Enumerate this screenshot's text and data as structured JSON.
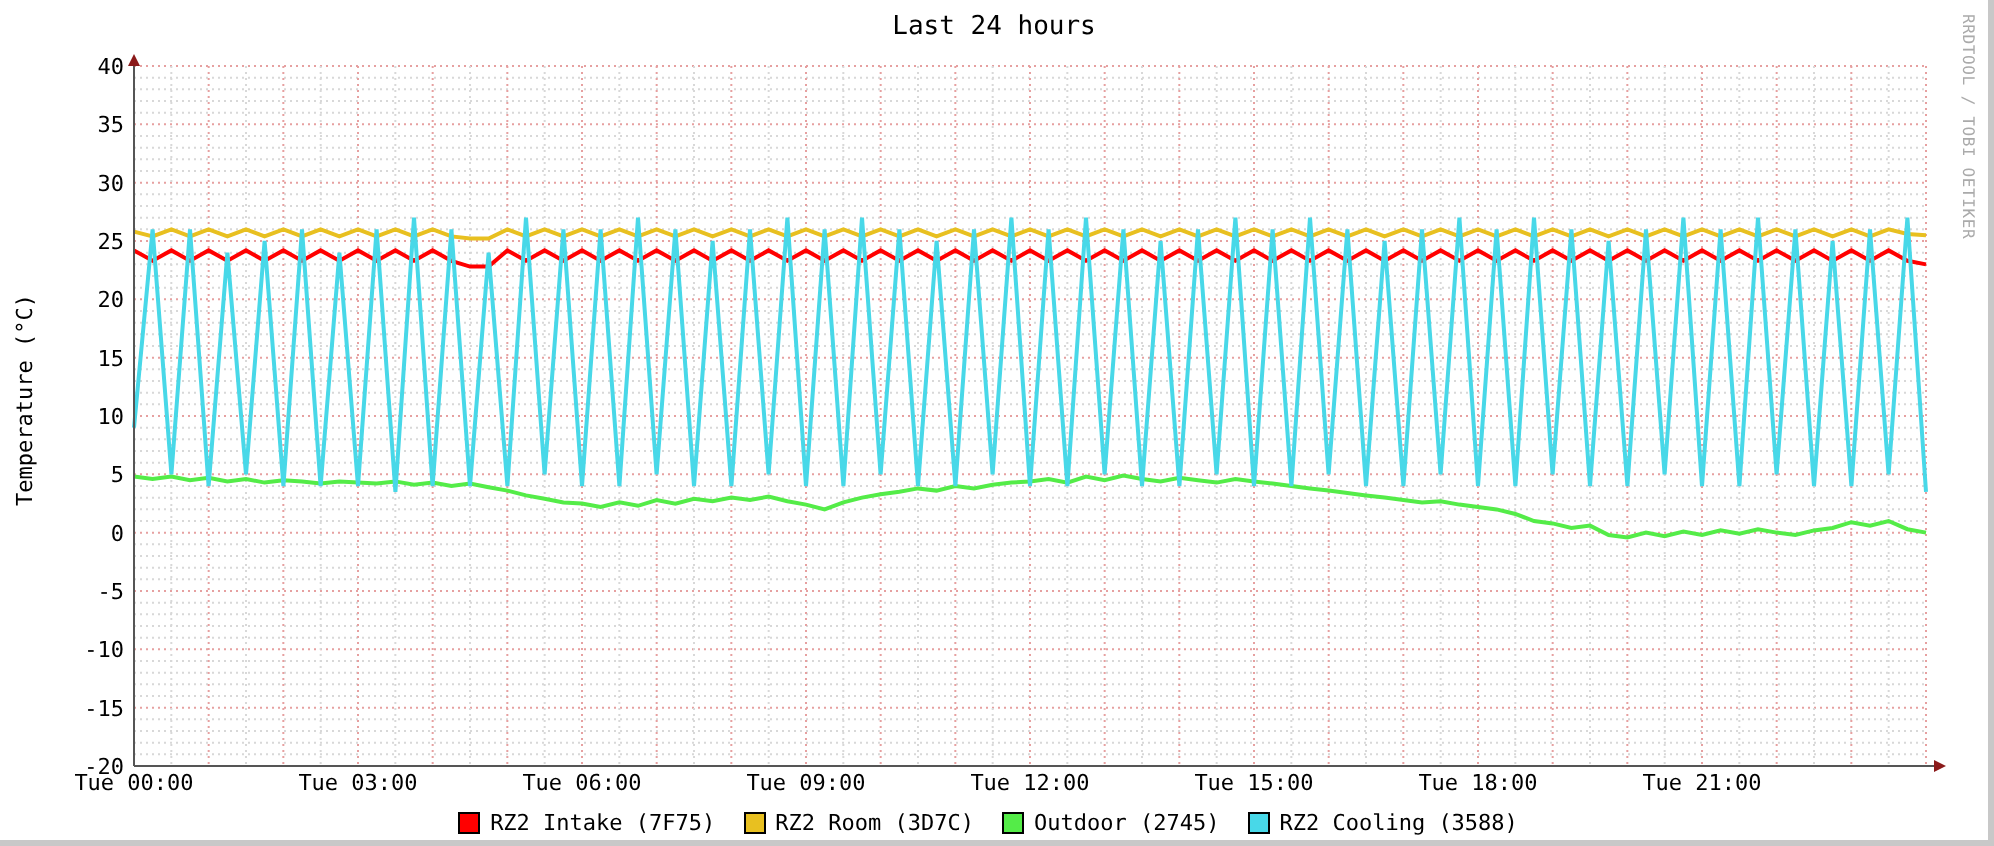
{
  "graph": {
    "credit": "RRDTOOL / TOBI OETIKER",
    "chart_data": {
      "type": "line",
      "grid": true,
      "title": "Last 24 hours",
      "ylabel": "Temperature (°C)",
      "ylim": [
        -20,
        40
      ],
      "yticks": [
        -20,
        -15,
        -10,
        -5,
        0,
        5,
        10,
        15,
        20,
        25,
        30,
        35,
        40
      ],
      "categories": [
        "Tue 00:00",
        null,
        null,
        null,
        null,
        null,
        null,
        null,
        null,
        null,
        null,
        null,
        "Tue 03:00",
        null,
        null,
        null,
        null,
        null,
        null,
        null,
        null,
        null,
        null,
        null,
        "Tue 06:00",
        null,
        null,
        null,
        null,
        null,
        null,
        null,
        null,
        null,
        null,
        null,
        "Tue 09:00",
        null,
        null,
        null,
        null,
        null,
        null,
        null,
        null,
        null,
        null,
        null,
        "Tue 12:00",
        null,
        null,
        null,
        null,
        null,
        null,
        null,
        null,
        null,
        null,
        null,
        "Tue 15:00",
        null,
        null,
        null,
        null,
        null,
        null,
        null,
        null,
        null,
        null,
        null,
        "Tue 18:00",
        null,
        null,
        null,
        null,
        null,
        null,
        null,
        null,
        null,
        null,
        null,
        "Tue 21:00",
        null,
        null,
        null,
        null,
        null,
        null,
        null,
        null,
        null,
        null,
        null,
        null
      ],
      "series": [
        {
          "name": "RZ2 Intake (7F75)",
          "color": "#ff0000",
          "values": [
            24.2,
            23.3,
            24.2,
            23.3,
            24.2,
            23.3,
            24.2,
            23.3,
            24.2,
            23.3,
            24.2,
            23.3,
            24.2,
            23.3,
            24.2,
            23.3,
            24.2,
            23.3,
            22.8,
            22.8,
            24.2,
            23.3,
            24.2,
            23.3,
            24.2,
            23.3,
            24.2,
            23.3,
            24.2,
            23.3,
            24.2,
            23.3,
            24.2,
            23.3,
            24.2,
            23.3,
            24.2,
            23.3,
            24.2,
            23.3,
            24.2,
            23.3,
            24.2,
            23.3,
            24.2,
            23.3,
            24.2,
            23.3,
            24.2,
            23.3,
            24.2,
            23.3,
            24.2,
            23.3,
            24.2,
            23.3,
            24.2,
            23.3,
            24.2,
            23.3,
            24.2,
            23.3,
            24.2,
            23.3,
            24.2,
            23.3,
            24.2,
            23.3,
            24.2,
            23.3,
            24.2,
            23.3,
            24.2,
            23.3,
            24.2,
            23.3,
            24.2,
            23.3,
            24.2,
            23.3,
            24.2,
            23.3,
            24.2,
            23.3,
            24.2,
            23.3,
            24.2,
            23.3,
            24.2,
            23.3,
            24.2,
            23.3,
            24.2,
            23.3,
            24.2,
            23.3,
            23.0
          ]
        },
        {
          "name": "RZ2 Room (3D7C)",
          "color": "#e8c020",
          "values": [
            25.8,
            25.4,
            26.0,
            25.4,
            26.0,
            25.4,
            26.0,
            25.4,
            26.0,
            25.4,
            26.0,
            25.4,
            26.0,
            25.4,
            26.0,
            25.4,
            26.0,
            25.4,
            25.2,
            25.2,
            26.0,
            25.4,
            26.0,
            25.4,
            26.0,
            25.4,
            26.0,
            25.4,
            26.0,
            25.4,
            26.0,
            25.4,
            26.0,
            25.4,
            26.0,
            25.4,
            26.0,
            25.4,
            26.0,
            25.4,
            26.0,
            25.4,
            26.0,
            25.4,
            26.0,
            25.4,
            26.0,
            25.4,
            26.0,
            25.4,
            26.0,
            25.4,
            26.0,
            25.4,
            26.0,
            25.4,
            26.0,
            25.4,
            26.0,
            25.4,
            26.0,
            25.4,
            26.0,
            25.4,
            26.0,
            25.4,
            26.0,
            25.4,
            26.0,
            25.4,
            26.0,
            25.4,
            26.0,
            25.4,
            26.0,
            25.4,
            26.0,
            25.4,
            26.0,
            25.4,
            26.0,
            25.4,
            26.0,
            25.4,
            26.0,
            25.4,
            26.0,
            25.4,
            26.0,
            25.4,
            26.0,
            25.4,
            26.0,
            25.4,
            26.0,
            25.6,
            25.5
          ]
        },
        {
          "name": "Outdoor (2745)",
          "color": "#54ec48",
          "values": [
            4.8,
            4.6,
            4.8,
            4.5,
            4.7,
            4.4,
            4.6,
            4.3,
            4.5,
            4.4,
            4.2,
            4.4,
            4.3,
            4.2,
            4.4,
            4.1,
            4.3,
            4.0,
            4.2,
            3.9,
            3.6,
            3.2,
            2.9,
            2.6,
            2.5,
            2.2,
            2.6,
            2.3,
            2.8,
            2.5,
            2.9,
            2.7,
            3.0,
            2.8,
            3.1,
            2.7,
            2.4,
            2.0,
            2.6,
            3.0,
            3.3,
            3.5,
            3.8,
            3.6,
            4.0,
            3.8,
            4.1,
            4.3,
            4.4,
            4.6,
            4.3,
            4.8,
            4.5,
            4.9,
            4.6,
            4.4,
            4.7,
            4.5,
            4.3,
            4.6,
            4.4,
            4.2,
            4.0,
            3.8,
            3.6,
            3.4,
            3.2,
            3.0,
            2.8,
            2.6,
            2.7,
            2.4,
            2.2,
            2.0,
            1.6,
            1.0,
            0.8,
            0.4,
            0.6,
            -0.2,
            -0.4,
            0.0,
            -0.3,
            0.1,
            -0.2,
            0.2,
            -0.1,
            0.3,
            0.0,
            -0.2,
            0.2,
            0.4,
            0.9,
            0.6,
            1.0,
            0.3,
            0.0
          ]
        },
        {
          "name": "RZ2 Cooling (3588)",
          "color": "#48d8e8",
          "values": [
            9,
            26,
            5,
            26,
            4,
            24,
            5,
            25,
            4,
            26,
            4,
            24,
            4,
            26,
            3.5,
            27,
            4,
            26,
            4,
            24,
            4,
            27,
            5,
            26,
            4,
            26,
            4,
            27,
            5,
            26,
            4,
            25,
            4,
            26,
            5,
            27,
            4,
            26,
            4,
            27,
            5,
            26,
            4,
            25,
            4,
            26,
            5,
            27,
            4,
            26,
            4,
            27,
            5,
            26,
            4,
            25,
            4,
            26,
            5,
            27,
            4,
            26,
            4,
            27,
            5,
            26,
            4,
            25,
            4,
            26,
            5,
            27,
            4,
            26,
            4,
            27,
            5,
            26,
            4,
            25,
            4,
            26,
            5,
            27,
            4,
            26,
            4,
            27,
            5,
            26,
            4,
            25,
            4,
            26,
            5,
            27,
            3.5
          ]
        }
      ]
    }
  }
}
